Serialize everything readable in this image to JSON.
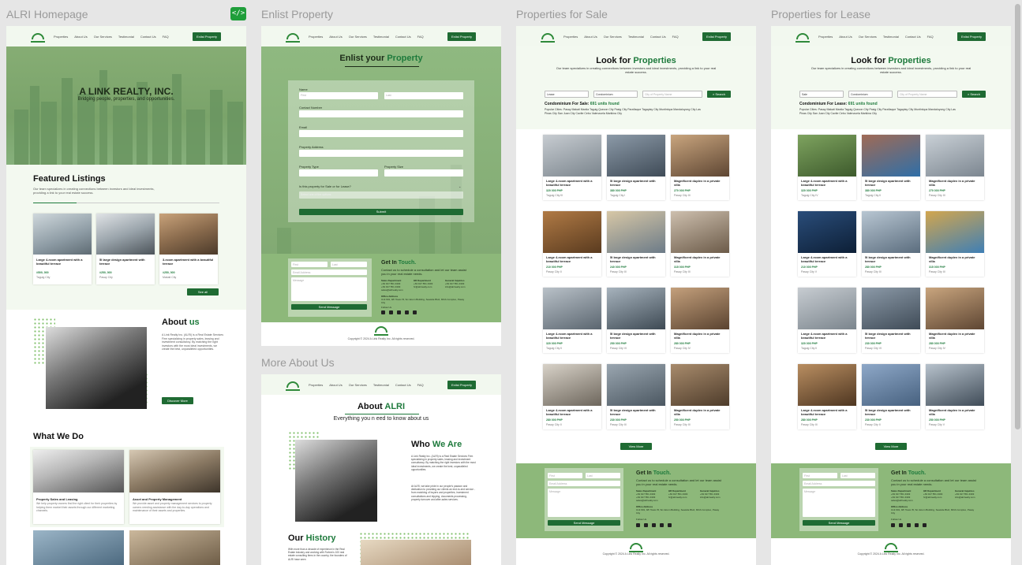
{
  "frames": {
    "home": "ALRI Homepage",
    "enlist": "Enlist Property",
    "more": "More About Us",
    "sale": "Properties for Sale",
    "lease": "Properties for Lease"
  },
  "nav": {
    "links": [
      "Properties",
      "About Us",
      "Our Services",
      "Testimonial",
      "Contact Us",
      "FAQ"
    ],
    "button": "Enlist Property"
  },
  "code_icon": "code-icon",
  "home": {
    "hero_title": "A LINK REALTY, INC.",
    "hero_sub": "Bridging people, properties, and opportunities.",
    "featured_title": "Featured Listings",
    "featured_desc": "Our team specializes in creating connections between investors and ideal investments, providing a link to your real estate success.",
    "listings": [
      {
        "title": "Large 4-room apartment with a beautiful terrace",
        "price": "#500, 000",
        "loc": "Taguig City"
      },
      {
        "title": "5I large design apartment with terrace",
        "price": "#250, 000",
        "loc": "Pasay City"
      },
      {
        "title": "3-room apartment with a beautiful terrace",
        "price": "#250, 000",
        "loc": "Makati City"
      }
    ],
    "see_all": "See all",
    "about_title": "About",
    "about_title_g": "us",
    "about_text": "A Link Realty Inc. (ALRI) is a Real Estate Services Firm specializing in property sales, leasing and investment consultancy. By matching the right investors with the most ideal investments, we create the best, unparalleled opportunities.",
    "discover": "Discover More",
    "whatwedo": "What We Do",
    "services": [
      {
        "title": "Property Sales and Leasing",
        "desc": "We help property owners find the right client for their properties by helping them market their assets through our different marketing channels."
      },
      {
        "title": "Asset and Property Management",
        "desc": "We provide asset and property management services to property owners needing assistance with the day-to-day operations and maintenance of their assets and properties."
      }
    ]
  },
  "enlist": {
    "title": "Enlist your",
    "title_g": "Property",
    "labels": {
      "name": "Name",
      "first": "First",
      "last": "Last",
      "contact": "Contact Number",
      "email": "Email",
      "address": "Property Address",
      "type": "Property Type",
      "size": "Property Size",
      "sale_lease": "Is this property for Sale or for Lease?",
      "select": "Select one of the options"
    },
    "submit": "Submit"
  },
  "contact": {
    "title": "Get In",
    "title_g": "Touch.",
    "sub": "Contact us to schedule a consultation and let our team assist you in your real estate needs.",
    "depts": [
      {
        "name": "Sales Department",
        "lines": [
          "+63 917 551 4303",
          "+63 917 551 4303",
          "sales@alrirealty.com"
        ]
      },
      {
        "name": "HR Department",
        "lines": [
          "+63 917 551 4303",
          "hr@alrirealty.com"
        ]
      },
      {
        "name": "General Inquiries",
        "lines": [
          "+63 917 551 4303",
          "info@alrirealty.com"
        ]
      }
    ],
    "office_label": "Office Address",
    "office": "Unit 901, 9/F Tower B, Sm Ecom Building, Seaside Blvd, MOA Complex, Pasay City",
    "follow": "Follow Us",
    "first": "First",
    "last": "Last",
    "email": "Email Address",
    "message": "Message",
    "send": "Send Message",
    "copyright": "Copyright © 2024 A Link Realty Inc. All rights reserved."
  },
  "more": {
    "about_title": "About",
    "about_title_g": "ALRI",
    "about_sub": "Everything you n eed to know about us",
    "who_title": "Who",
    "who_title_g": "We Are",
    "who_text": "A Link Realty Inc. (ALRI) is a Real Estate Services Firm specializing in property sales, leasing and investment consultancy. By matching the right investors with the most ideal investments, we create the best, unparalleled opportunities.",
    "who_text2": "At ALRI, we take pride in our people's passion and dedication to providing our clients an end-to-end service - from matching of buyers and properties, investment consultations and tripping, documents processing, property turnover and after-sales services.",
    "history_title": "Our",
    "history_title_g": "History",
    "history_text": "With more than a decade of experience in the Real Estate industry and working with Forbes's 100 real estate consulting firms in the country, the founders of ALRI have seen"
  },
  "sale": {
    "title": "Look for",
    "title_g": "Properties",
    "sub": "Our team specializes in creating connections between investors and ideal investments, providing a link to your real estate success.",
    "filter1": "Lease",
    "filter2": "Condominium",
    "search_ph": "City of Property Name",
    "search_btn": "Search",
    "count_prefix": "Condominium For Sale:",
    "count_g": "691 units found",
    "popular_label": "Popular Cities:",
    "popular": "Pasay Makati Manila Taguig Quezon City Pasig City Parañaque Tagaytay City Muntinlupa Mandaluyong City Las Pinas City San Juan City Cavite Cebu Valenzuela Marikina City",
    "cards": [
      {
        "t": "Large 4-room apartment with a beautiful terrace",
        "p": "320 000 PHP",
        "l": "Taguig City III"
      },
      {
        "t": "5I large design apartment with terrace",
        "p": "380 000 PHP",
        "l": "Taguig City I"
      },
      {
        "t": "Magnificent duplex in a private villa",
        "p": "270 000 PHP",
        "l": "Pasay City III"
      },
      {
        "t": "Large 4-room apartment with a beautiful terrace",
        "p": "210 000 PHP",
        "l": "Pasay City II"
      },
      {
        "t": "5I large design apartment with terrace",
        "p": "240 000 PHP",
        "l": "Pasay City III"
      },
      {
        "t": "Magnificent duplex in a private villa",
        "p": "315 000 PHP",
        "l": "Pasay City III"
      },
      {
        "t": "Large 4-room apartment with a beautiful terrace",
        "p": "320 000 PHP",
        "l": "Taguig City II"
      },
      {
        "t": "5I large design apartment with terrace",
        "p": "250 000 PHP",
        "l": "Pasay City VI"
      },
      {
        "t": "Magnificent duplex in a private villa",
        "p": "280 000 PHP",
        "l": "Pasay City IV"
      },
      {
        "t": "Large 4-room apartment with a beautiful terrace",
        "p": "280 000 PHP",
        "l": "Pasay City II"
      },
      {
        "t": "5I large design apartment with terrace",
        "p": "230 000 PHP",
        "l": "Pasay City III"
      },
      {
        "t": "Magnificent duplex in a private villa",
        "p": "250 000 PHP",
        "l": "Pasay City III"
      }
    ],
    "view_more": "View More"
  },
  "lease": {
    "title": "Look for",
    "title_g": "Properties",
    "sub": "Our team specializes in creating connections between investors and ideal investments, providing a link to your real estate success.",
    "filter1": "Sale",
    "filter2": "Condominium",
    "search_ph": "City of Property Name",
    "search_btn": "Search",
    "count_prefix": "Condominium For Lease:",
    "count_g": "691 units found",
    "popular_label": "Popular Cities:",
    "popular": "Pasay Makati Manila Taguig Quezon City Pasig City Parañaque Tagaytay City Muntinlupa Mandaluyong City Las Pinas City San Juan City Cavite Cebu Valenzuela Marikina City",
    "cards": [
      {
        "t": "Large 4-room apartment with a beautiful terrace",
        "p": "320 000 PHP",
        "l": "Taguig City IV"
      },
      {
        "t": "5I large design apartment with terrace",
        "p": "380 000 PHP",
        "l": "Taguig City II"
      },
      {
        "t": "Magnificent duplex in a private villa",
        "p": "270 000 PHP",
        "l": "Pasay City III"
      },
      {
        "t": "Large 4-room apartment with a beautiful terrace",
        "p": "210 000 PHP",
        "l": "Pasay City V"
      },
      {
        "t": "5I large design apartment with terrace",
        "p": "280 000 PHP",
        "l": "Pasay City III"
      },
      {
        "t": "Magnificent duplex in a private villa",
        "p": "315 000 PHP",
        "l": "Pasay City III"
      },
      {
        "t": "Large 4-room apartment with a beautiful terrace",
        "p": "320 000 PHP",
        "l": "Taguig City II"
      },
      {
        "t": "5I large design apartment with terrace",
        "p": "230 000 PHP",
        "l": "Pasay City VI"
      },
      {
        "t": "Magnificent duplex in a private villa",
        "p": "280 000 PHP",
        "l": "Pasay City IV"
      },
      {
        "t": "Large 4-room apartment with a beautiful terrace",
        "p": "280 000 PHP",
        "l": "Pasay City III"
      },
      {
        "t": "5I large design apartment with terrace",
        "p": "230 000 PHP",
        "l": "Pasay City II"
      },
      {
        "t": "Magnificent duplex in a private villa",
        "p": "250 000 PHP",
        "l": "Pasay City V"
      }
    ],
    "view_more": "View More"
  },
  "colors": {
    "brand": "#1f6b33",
    "accent": "#1e7a3c",
    "hero": "#7fa86f",
    "footer": "#8db87a"
  }
}
